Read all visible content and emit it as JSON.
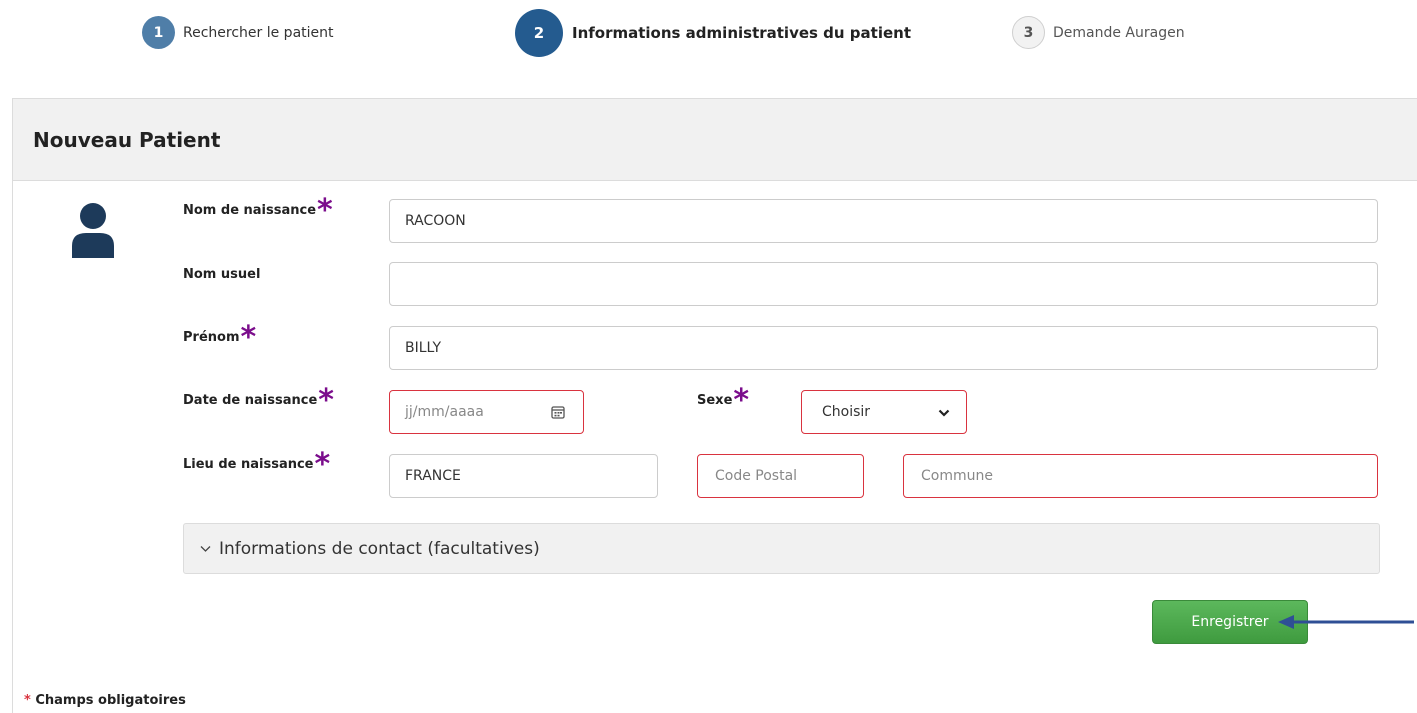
{
  "stepper": {
    "steps": [
      {
        "number": "1",
        "label": "Rechercher le patient"
      },
      {
        "number": "2",
        "label": "Informations administratives du patient"
      },
      {
        "number": "3",
        "label": "Demande Auragen"
      }
    ],
    "active_step": "2"
  },
  "panel": {
    "title": "Nouveau Patient"
  },
  "form": {
    "nom_naissance": {
      "label": "Nom de naissance",
      "value": "RACOON"
    },
    "nom_usuel": {
      "label": "Nom usuel",
      "value": ""
    },
    "prenom": {
      "label": "Prénom",
      "value": "BILLY"
    },
    "date_naissance": {
      "label": "Date de naissance",
      "placeholder": "jj/mm/aaaa"
    },
    "sexe": {
      "label": "Sexe",
      "value": "Choisir"
    },
    "lieu_naissance": {
      "label": "Lieu de naissance",
      "pays": "FRANCE",
      "code_postal_placeholder": "Code Postal",
      "commune_placeholder": "Commune"
    },
    "required_mark": "*"
  },
  "accordion": {
    "label": "Informations de contact (facultatives)"
  },
  "actions": {
    "save_label": "Enregistrer"
  },
  "footer": {
    "required_star": "*",
    "required_note": "Champs obligatoires"
  },
  "colors": {
    "primary": "#245b8f",
    "success": "#5cb85c",
    "error": "#d9333f",
    "required": "#7b0d8c",
    "annotation_arrow": "#2f4f95"
  }
}
